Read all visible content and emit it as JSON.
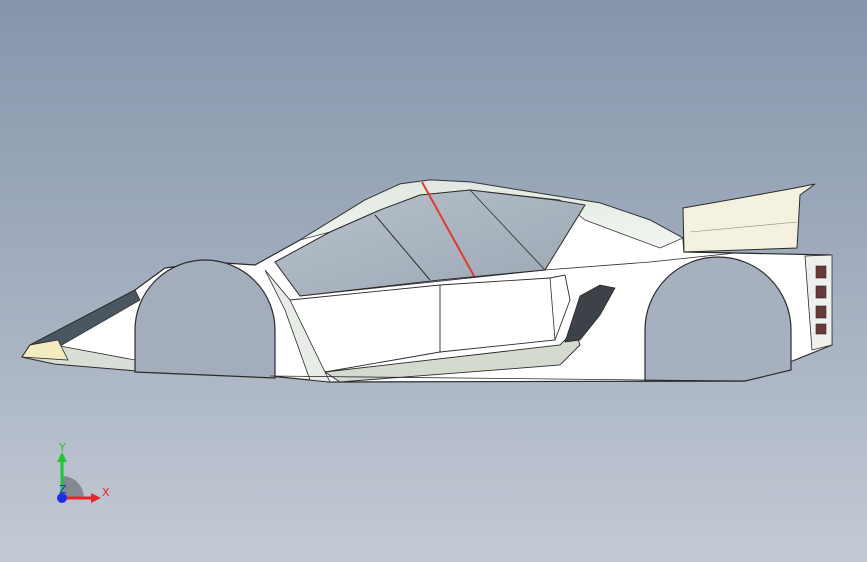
{
  "viewport": {
    "background_top": "#8795ab",
    "background_bottom": "#c4cad5"
  },
  "model": {
    "name": "race-car-body",
    "view": "side"
  },
  "triad": {
    "y_label": "Y",
    "x_label": "X",
    "z_label": "Z",
    "x_color": "#e8262a",
    "y_color": "#22c532",
    "z_color": "#1b2fe0"
  }
}
